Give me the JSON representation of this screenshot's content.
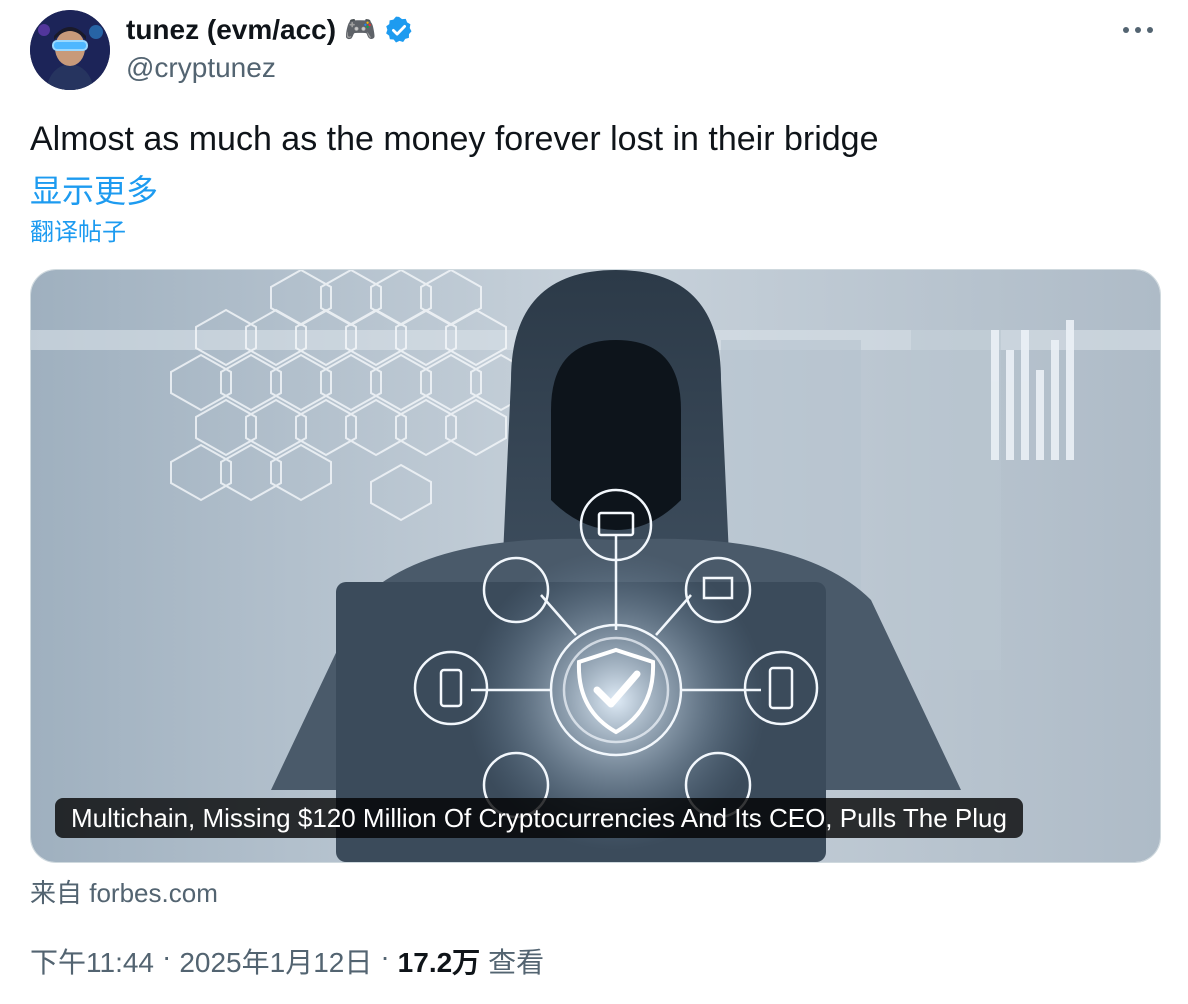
{
  "author": {
    "display_name": "tunez (evm/acc)",
    "badge_emoji": "🎮",
    "handle": "@cryptunez",
    "verified": true,
    "verified_color": "#1d9bf0"
  },
  "tweet": {
    "text": "Almost as much as the money forever lost in their bridge",
    "show_more": "显示更多",
    "translate": "翻译帖子"
  },
  "card": {
    "title": "Multichain, Missing $120 Million Of Cryptocurrencies And Its CEO, Pulls The Plug",
    "source_prefix": "来自",
    "source_domain": "forbes.com"
  },
  "meta": {
    "time": "下午11:44",
    "separator": "·",
    "date": "2025年1月12日",
    "views_count": "17.2万",
    "views_label": "查看"
  },
  "colors": {
    "link": "#1d9bf0",
    "secondary_text": "#536471",
    "primary_text": "#0f1419"
  }
}
